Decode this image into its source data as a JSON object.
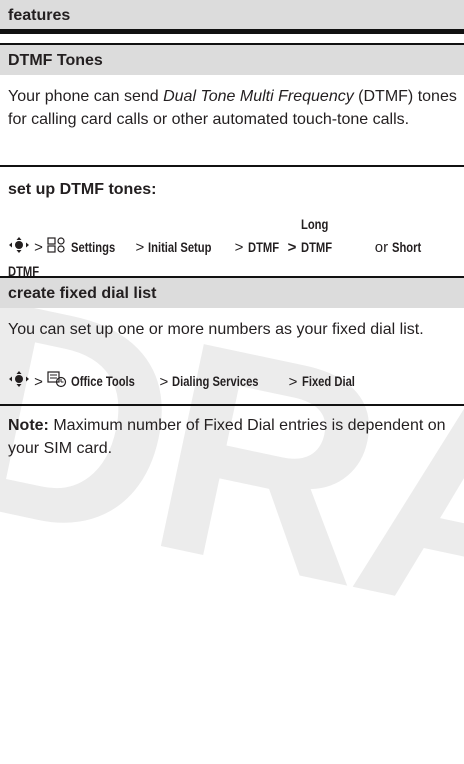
{
  "header": {
    "title": "features"
  },
  "dtmf": {
    "title": "DTMF Tones",
    "body_pre": "Your phone can send ",
    "body_italic": "Dual Tone Multi Frequency",
    "body_post": " (DTMF) tones for calling card calls or other automated touch-tone calls.",
    "setup_heading": "set up DTMF tones:",
    "path": {
      "sep": ">",
      "settings": "Settings",
      "initial_setup": "Initial Setup",
      "dtmf": "DTMF",
      "long_dtmf": "Long DTMF",
      "or": "or",
      "short_dtmf_a": "Short",
      "short_dtmf_b": "DTMF"
    }
  },
  "fixed": {
    "title": "create fixed dial list",
    "body": "You can set up one or more numbers as your fixed dial list.",
    "path": {
      "sep": ">",
      "office_tools": "Office Tools",
      "dialing_services": "Dialing Services",
      "fixed_dial": "Fixed Dial"
    },
    "note_label": "Note:",
    "note_text": " Maximum number of Fixed Dial entries is dependent on your SIM card."
  },
  "watermark": "DRAFT",
  "icons": {
    "nav": "nav-key-icon",
    "settings": "settings-icon",
    "office": "office-tools-icon"
  }
}
